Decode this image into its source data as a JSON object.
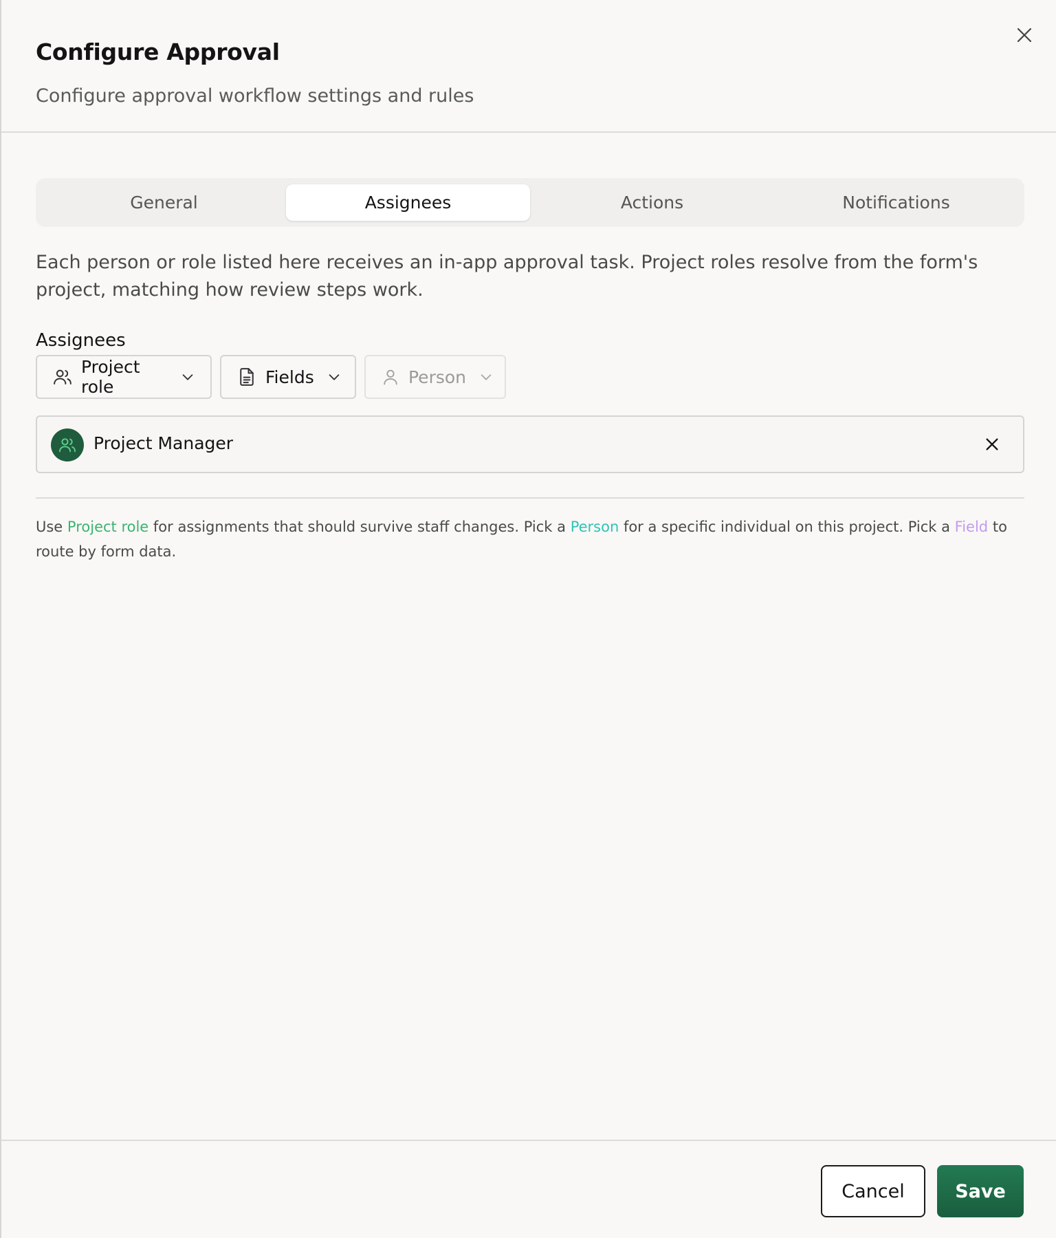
{
  "dialog": {
    "title": "Configure Approval",
    "subtitle": "Configure approval workflow settings and rules",
    "close_icon": "close-icon"
  },
  "tabs": [
    {
      "label": "General",
      "active": false
    },
    {
      "label": "Assignees",
      "active": true
    },
    {
      "label": "Actions",
      "active": false
    },
    {
      "label": "Notifications",
      "active": false
    }
  ],
  "assignees_tab": {
    "description": "Each person or role listed here receives an in-app approval task. Project roles resolve from the form's project, matching how review steps work.",
    "section_label": "Assignees",
    "pickers": [
      {
        "label": "Project role",
        "icon": "users-icon",
        "enabled": true
      },
      {
        "label": "Fields",
        "icon": "document-icon",
        "enabled": true
      },
      {
        "label": "Person",
        "icon": "user-icon",
        "enabled": false
      }
    ],
    "selected": [
      {
        "label": "Project Manager",
        "icon": "users-icon"
      }
    ],
    "hint": {
      "part1": "Use ",
      "role_link": "Project role",
      "part2": " for assignments that should survive staff changes. Pick a ",
      "person_link": "Person",
      "part3": " for a specific individual on this project. Pick a ",
      "field_link": "Field",
      "part4": " to route by form data."
    }
  },
  "footer": {
    "cancel_label": "Cancel",
    "save_label": "Save"
  },
  "colors": {
    "accent": "#1d6a47",
    "role_highlight": "#3cb371",
    "person_highlight": "#2ec4b6",
    "field_highlight": "#c39bf0"
  }
}
